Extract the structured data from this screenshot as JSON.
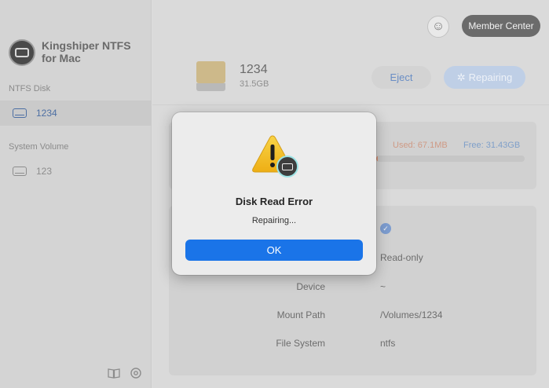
{
  "app": {
    "name": "Kingshiper NTFS for Mac"
  },
  "sidebar": {
    "ntfs_section": "NTFS Disk",
    "ntfs_items": [
      {
        "label": "1234"
      }
    ],
    "system_section": "System Volume",
    "system_items": [
      {
        "label": "123"
      }
    ]
  },
  "header": {
    "member_center": "Member Center",
    "disk_name": "1234",
    "disk_size": "31.5GB",
    "eject_label": "Eject",
    "repairing_label": "Repairing"
  },
  "usage": {
    "used_text": "Used: 67.1MB",
    "free_text": "Free: 31.43GB",
    "used_fraction": 0.002
  },
  "info": {
    "rows": [
      {
        "key": "",
        "value": ""
      },
      {
        "key": "",
        "value": "Read-only"
      },
      {
        "key": "Device",
        "value": "~"
      },
      {
        "key": "Mount Path",
        "value": "/Volumes/1234"
      },
      {
        "key": "File System",
        "value": "ntfs"
      }
    ]
  },
  "dialog": {
    "title": "Disk Read Error",
    "message": "Repairing...",
    "ok_label": "OK"
  },
  "colors": {
    "accent": "#1a74e8",
    "used": "#cf9a85",
    "free": "#7f9fc9"
  },
  "icons": {
    "warning": "warning-triangle-icon",
    "disk": "disk-icon",
    "book": "book-icon",
    "settings": "gear-icon"
  }
}
